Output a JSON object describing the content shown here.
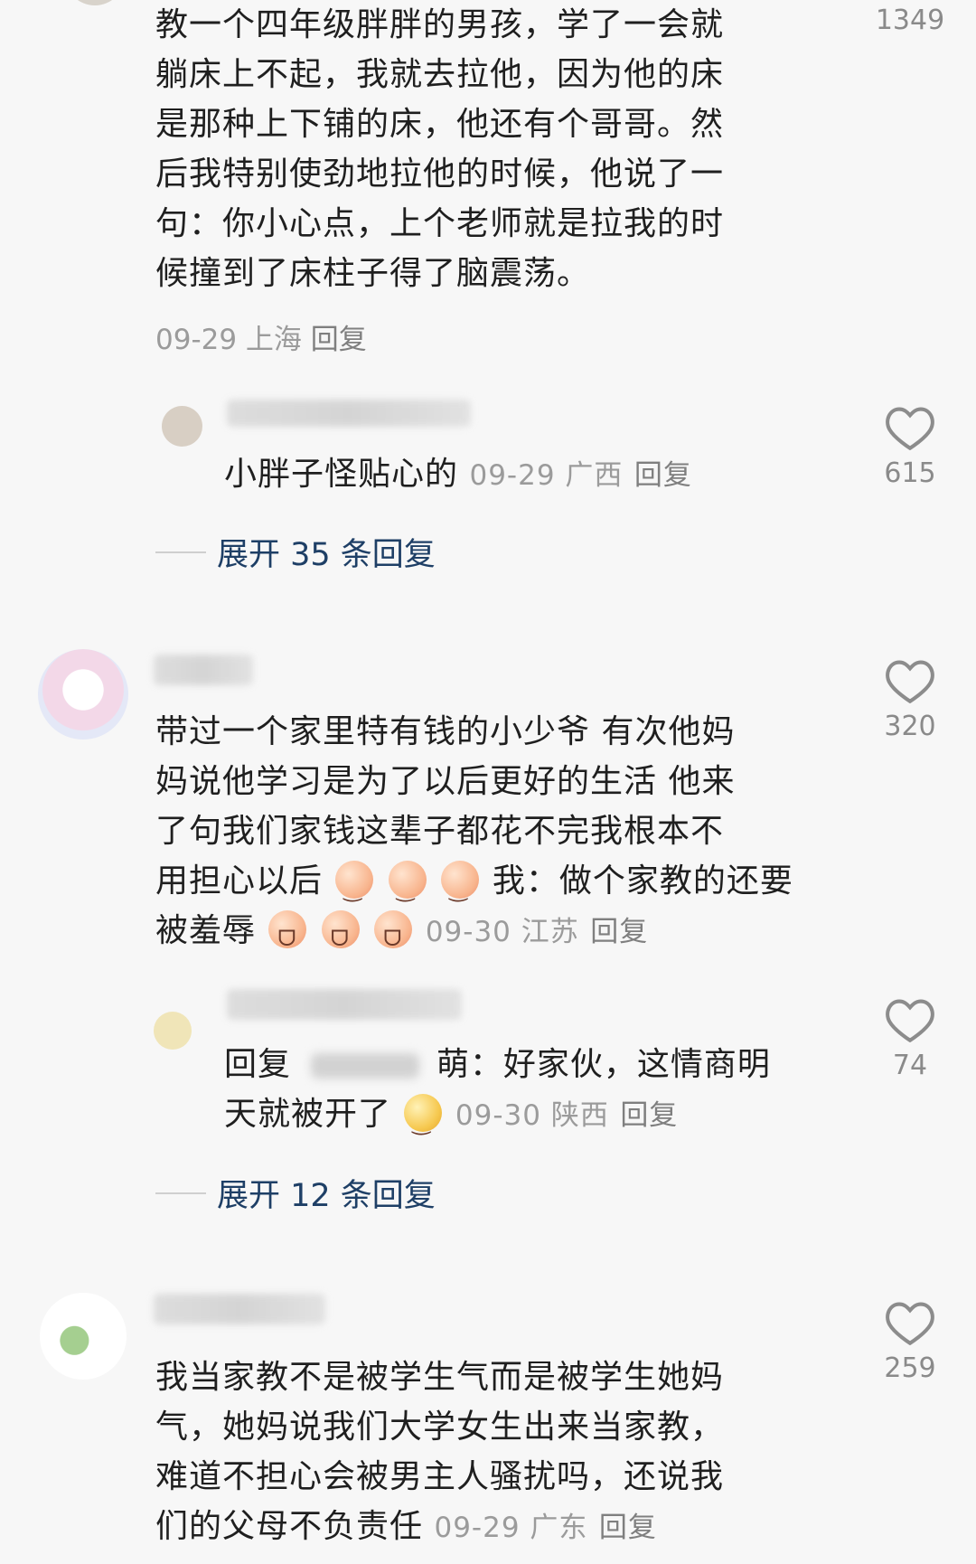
{
  "comments": [
    {
      "text_lines": [
        "教一个四年级胖胖的男孩，学了一会就",
        "躺床上不起，我就去拉他，因为他的床",
        "是那种上下铺的床，他还有个哥哥。然",
        "后我特别使劲地拉他的时候，他说了一",
        "句：你小心点，上个老师就是拉我的时",
        "候撞到了床柱子得了脑震荡。"
      ],
      "meta": "09-29 上海",
      "reply_label": "回复",
      "likes": "1349",
      "replies": [
        {
          "text": "小胖子怪贴心的",
          "meta": "09-29 广西",
          "reply_label": "回复",
          "likes": "615"
        }
      ],
      "expand_label": "展开 35 条回复"
    },
    {
      "text_lines": [
        "带过一个家里特有钱的小少爷 有次他妈",
        "妈说他学习是为了以后更好的生活 他来",
        "了句我们家钱这辈子都花不完我根本不",
        "用担心以后",
        "我：做个家教的还要",
        "被羞辱"
      ],
      "meta": "09-30 江苏",
      "reply_label": "回复",
      "likes": "320",
      "replies": [
        {
          "text_prefix": "回复",
          "text_line1_suffix": "萌：好家伙，这情商明",
          "text_line2": "天就被开了",
          "meta": "09-30 陕西",
          "reply_label": "回复",
          "likes": "74"
        }
      ],
      "expand_label": "展开 12 条回复"
    },
    {
      "text_lines": [
        "我当家教不是被学生气而是被学生她妈",
        "气，她妈说我们大学女生出来当家教，",
        "难道不担心会被男主人骚扰吗，还说我",
        "们的父母不负责任"
      ],
      "meta": "09-29 广东",
      "reply_label": "回复",
      "likes": "259"
    }
  ],
  "icons": {
    "like": "heart-outline-icon"
  },
  "colors": {
    "background": "#f7f7f7",
    "text": "#1f1f1f",
    "meta": "#9b9b9b",
    "expand": "#1e3f66"
  }
}
